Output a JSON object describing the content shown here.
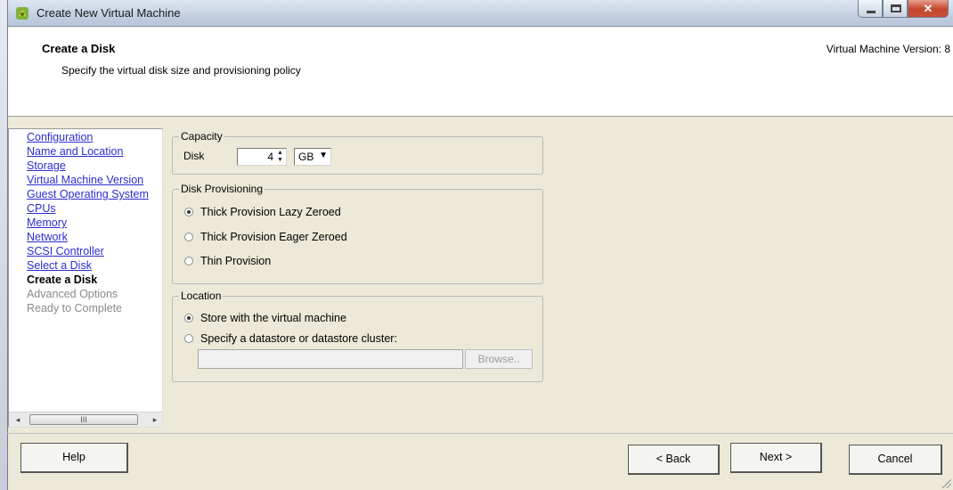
{
  "window": {
    "title": "Create New Virtual Machine"
  },
  "header": {
    "title": "Create a Disk",
    "subtitle": "Specify the virtual disk size and provisioning policy",
    "version": "Virtual Machine Version: 8"
  },
  "nav": {
    "items": [
      {
        "label": "Configuration",
        "state": "link"
      },
      {
        "label": "Name and Location",
        "state": "link"
      },
      {
        "label": "Storage",
        "state": "link"
      },
      {
        "label": "Virtual Machine Version",
        "state": "link"
      },
      {
        "label": "Guest Operating System",
        "state": "link"
      },
      {
        "label": "CPUs",
        "state": "link"
      },
      {
        "label": "Memory",
        "state": "link"
      },
      {
        "label": "Network",
        "state": "link"
      },
      {
        "label": "SCSI Controller",
        "state": "link"
      },
      {
        "label": "Select a Disk",
        "state": "link"
      },
      {
        "label": "Create a Disk",
        "state": "current"
      },
      {
        "label": "Advanced Options",
        "state": "disabled"
      },
      {
        "label": "Ready to Complete",
        "state": "disabled"
      }
    ],
    "scroll_left": "◂",
    "scroll_right": "▸",
    "scroll_thumb_grip": "III"
  },
  "capacity": {
    "legend": "Capacity",
    "disk_label": "Disk",
    "disk_size": "4",
    "unit": "GB",
    "unit_arrow": "▼",
    "spin_up": "▲",
    "spin_down": "▼"
  },
  "provisioning": {
    "legend": "Disk Provisioning",
    "options": [
      {
        "label": "Thick Provision Lazy Zeroed",
        "selected": true
      },
      {
        "label": "Thick Provision Eager Zeroed",
        "selected": false
      },
      {
        "label": "Thin Provision",
        "selected": false
      }
    ]
  },
  "location": {
    "legend": "Location",
    "options": [
      {
        "label": "Store with the virtual machine",
        "selected": true
      },
      {
        "label": "Specify a datastore or datastore cluster:",
        "selected": false
      }
    ],
    "datastore_value": "",
    "browse_label": "Browse.."
  },
  "footer": {
    "help_label": "Help",
    "back_label": "< Back",
    "next_label": "Next >",
    "cancel_label": "Cancel"
  }
}
